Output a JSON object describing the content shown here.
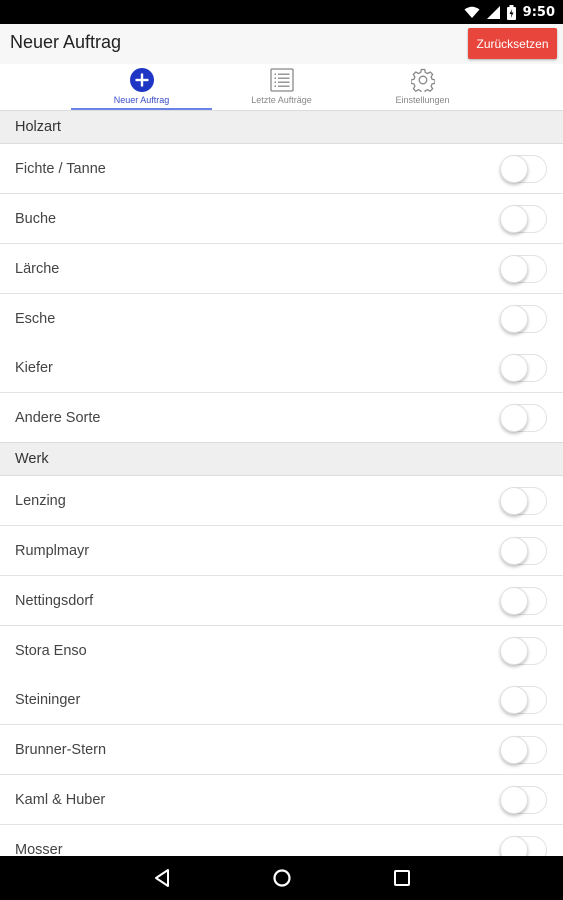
{
  "status_bar": {
    "time": "9:50",
    "icons": [
      "wifi-icon",
      "cell-signal-icon",
      "battery-icon"
    ]
  },
  "app_bar": {
    "title": "Neuer Auftrag",
    "reset_label": "Zurücksetzen",
    "reset_color": "#e8463c"
  },
  "tabs": [
    {
      "label": "Neuer Auftrag",
      "icon": "plus-circle-icon",
      "active": true
    },
    {
      "label": "Letzte Aufträge",
      "icon": "list-icon",
      "active": false
    },
    {
      "label": "Einstellungen",
      "icon": "gear-icon",
      "active": false
    }
  ],
  "sections": [
    {
      "header": "Holzart",
      "items": [
        {
          "label": "Fichte / Tanne",
          "on": false
        },
        {
          "label": "Buche",
          "on": false
        },
        {
          "label": "Lärche",
          "on": false
        },
        {
          "label": "Esche",
          "on": false
        },
        {
          "label": "Kiefer",
          "on": false
        },
        {
          "label": "Andere Sorte",
          "on": false
        }
      ]
    },
    {
      "header": "Werk",
      "items": [
        {
          "label": "Lenzing",
          "on": false
        },
        {
          "label": "Rumplmayr",
          "on": false
        },
        {
          "label": "Nettingsdorf",
          "on": false
        },
        {
          "label": "Stora Enso",
          "on": false
        },
        {
          "label": "Steininger",
          "on": false
        },
        {
          "label": "Brunner-Stern",
          "on": false
        },
        {
          "label": "Kaml & Huber",
          "on": false
        },
        {
          "label": "Mosser",
          "on": false
        }
      ]
    }
  ],
  "nav_bar": {
    "buttons": [
      "back-icon",
      "home-icon",
      "recents-icon"
    ]
  },
  "colors": {
    "accent": "#3a4fc7",
    "section_bg": "#efefef"
  }
}
